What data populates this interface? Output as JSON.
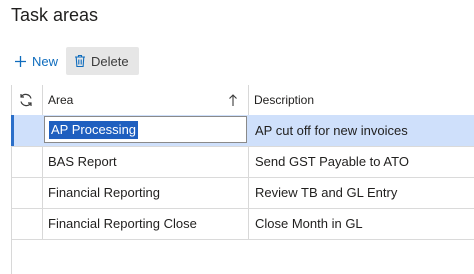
{
  "page": {
    "title": "Task areas"
  },
  "toolbar": {
    "new_label": "New",
    "delete_label": "Delete"
  },
  "grid": {
    "columns": {
      "area": "Area",
      "description": "Description"
    },
    "selected_index": 0,
    "rows": [
      {
        "area": "AP Processing",
        "description": "AP cut off for new invoices"
      },
      {
        "area": "BAS Report",
        "description": "Send GST Payable to ATO"
      },
      {
        "area": "Financial Reporting",
        "description": "Review TB and GL Entry"
      },
      {
        "area": "Financial Reporting Close",
        "description": "Close Month in GL"
      }
    ]
  },
  "colors": {
    "accent": "#0f6cbd",
    "selected_row": "#cfe0fb",
    "selection_text_bg": "#1f5fbf"
  }
}
